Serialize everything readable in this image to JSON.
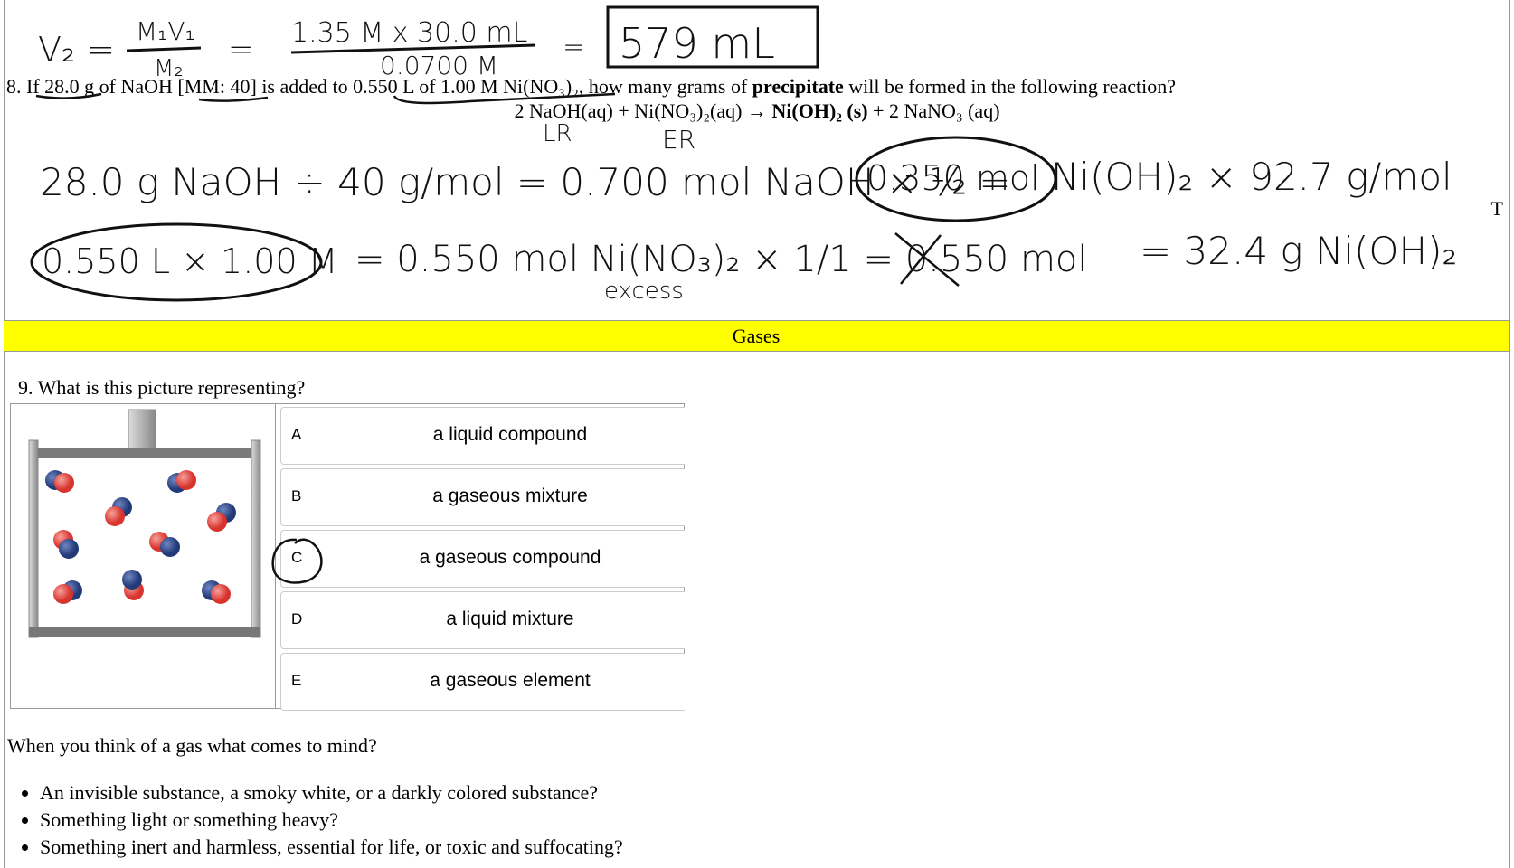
{
  "q8": {
    "number": "8.",
    "text_parts": [
      "If ",
      "28.0 g",
      " of NaOH ",
      "[MM: 40]",
      " is added to ",
      "0.550 L of 1.00 M Ni(NO₃)₂",
      ", how many grams of ",
      "precipitate",
      " will be formed in the following reaction?"
    ],
    "equation_left": "2 NaOH(aq) + Ni(NO₃)₂(aq) → ",
    "equation_bold": "Ni(OH)₂ (s)",
    "equation_right": " + 2 NaNO₃ (aq)"
  },
  "side_letter": "T",
  "handwriting": {
    "dilution_lhs": "V₂ =",
    "dilution_frac_num": "M₁V₁",
    "dilution_frac_den": "M₂",
    "dilution_eq": "=",
    "dilution_num": "1.35 M x 30.0 mL",
    "dilution_den": "0.0700 M",
    "dilution_eq2": "=",
    "dilution_answer": "579 mL",
    "lr": "LR",
    "er": "ER",
    "line1": "28.0 g NaOH ÷ 40 g/mol = 0.700 mol NaOH × ½ =",
    "line1_circled": "0.350 mol",
    "line1_tail": "Ni(OH)₂ × 92.7 g/mol",
    "line2_circled": "0.550 L × 1.00 M",
    "line2": "= 0.550 mol Ni(NO₃)₂ × 1/1 = 0.550 mol",
    "line2_answer": "= 32.4 g Ni(OH)₂",
    "excess": "excess"
  },
  "section_band": {
    "label": "Gases",
    "color": "#ffff00"
  },
  "q9": {
    "question": "9. What is this picture representing?",
    "options": [
      {
        "letter": "A",
        "text": "a liquid compound"
      },
      {
        "letter": "B",
        "text": "a gaseous mixture"
      },
      {
        "letter": "C",
        "text": "a gaseous compound",
        "circled": true
      },
      {
        "letter": "D",
        "text": "a liquid mixture"
      },
      {
        "letter": "E",
        "text": "a gaseous element"
      }
    ]
  },
  "think": {
    "prompt": "When you think of a gas what comes to mind?",
    "bullets": [
      "An invisible substance, a smoky white, or a darkly colored substance?",
      "Something light or something heavy?",
      "Something inert and harmless, essential for life, or toxic and suffocating?"
    ]
  },
  "colors": {
    "molecule_red": "#e0403a",
    "molecule_blue": "#2f4a8a",
    "container_gray": "#777777"
  }
}
